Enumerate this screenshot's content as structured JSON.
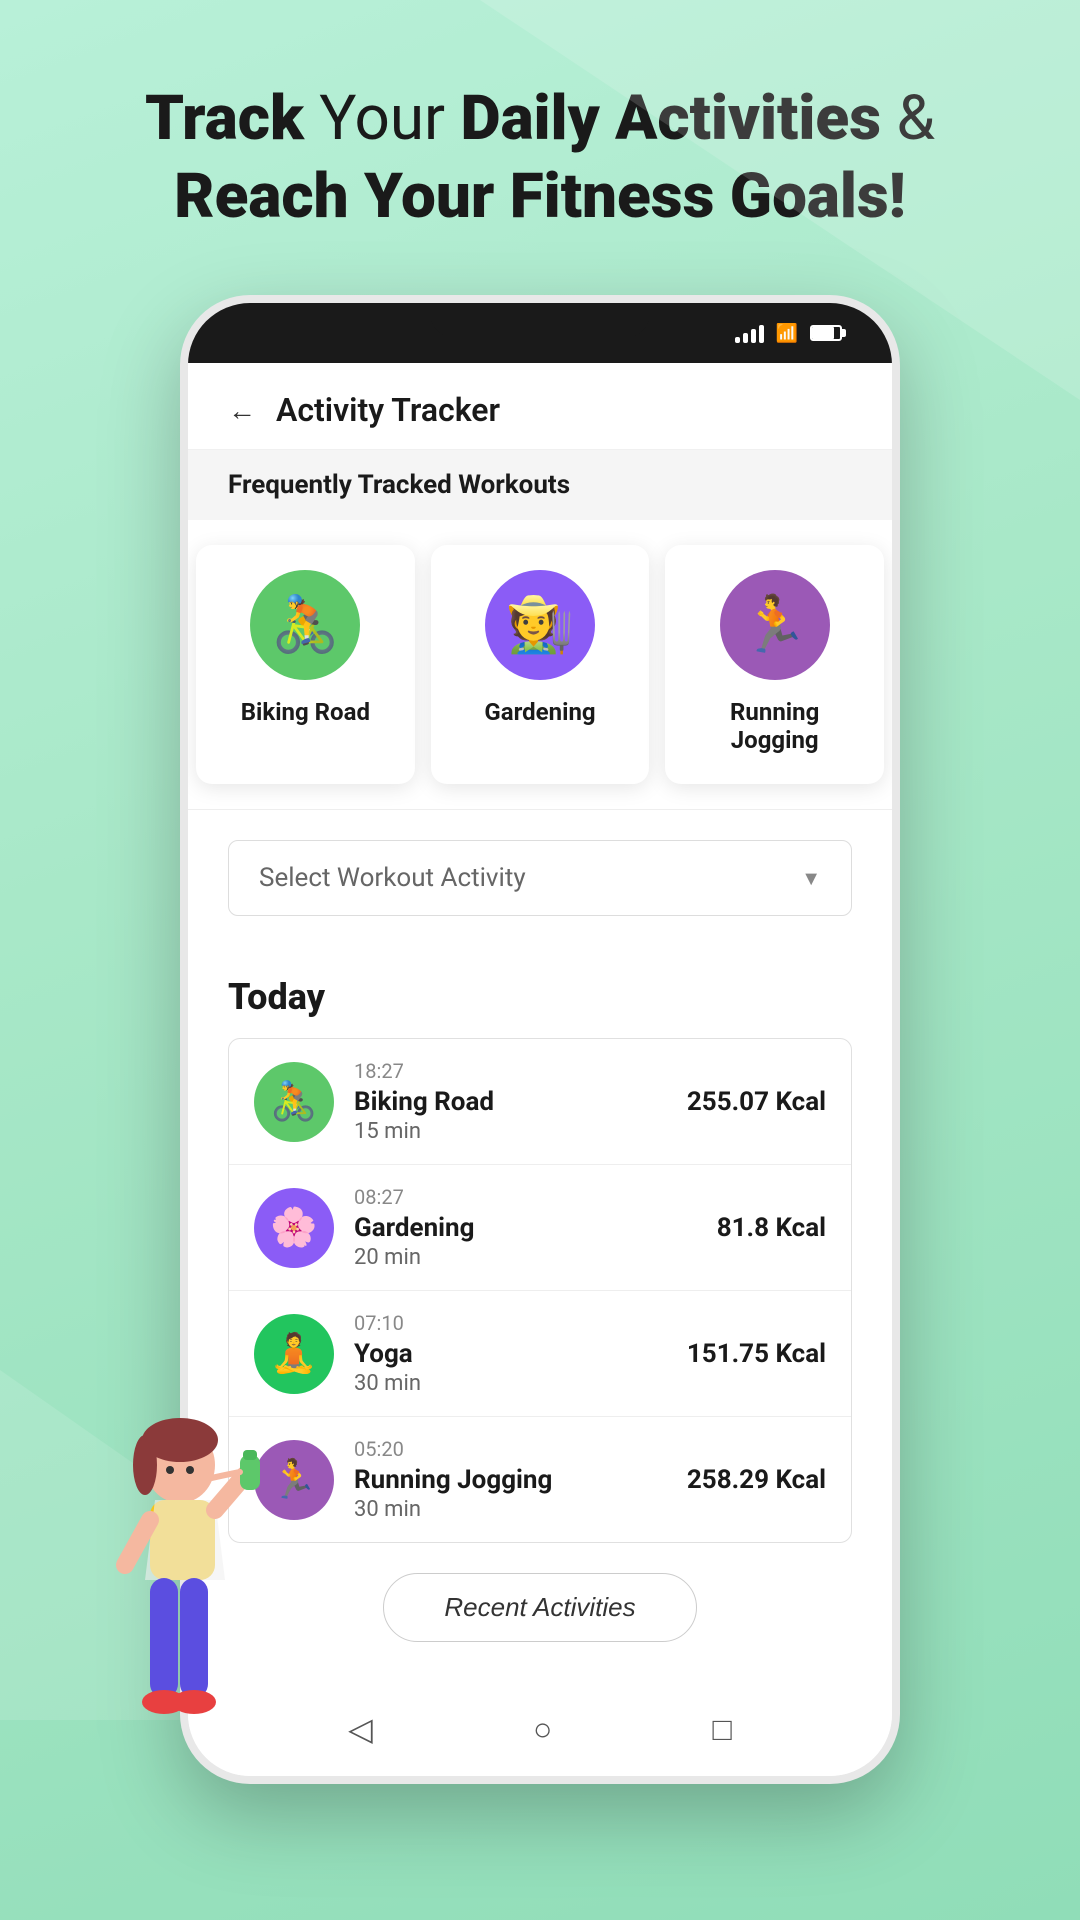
{
  "hero": {
    "line1_normal": "Track",
    "line1_bold1": " Your ",
    "line1_bold2": "Daily Activities",
    "line1_end": " &",
    "line2": "Reach Your Fitness Goals!"
  },
  "phone": {
    "app_title": "Activity Tracker",
    "back_label": "←",
    "section_label": "Frequently Tracked Workouts",
    "workouts": [
      {
        "name": "Biking Road",
        "emoji": "🚴",
        "bg": "#5DC86A",
        "id": "biking"
      },
      {
        "name": "Gardening",
        "emoji": "🧑‍🌾",
        "bg": "#8B5CF6",
        "id": "gardening"
      },
      {
        "name": "Running Jogging",
        "emoji": "🏃",
        "bg": "#9B59B6",
        "id": "running"
      }
    ],
    "dropdown": {
      "placeholder": "Select Workout Activity",
      "arrow": "▼"
    },
    "today_title": "Today",
    "activities": [
      {
        "time": "18:27",
        "name": "Biking Road",
        "duration": "15 min",
        "calories": "255.07 Kcal",
        "emoji": "🚴",
        "bg": "#5DC86A"
      },
      {
        "time": "08:27",
        "name": "Gardening",
        "duration": "20 min",
        "calories": "81.8 Kcal",
        "emoji": "🌸",
        "bg": "#8B5CF6"
      },
      {
        "time": "07:10",
        "name": "Yoga",
        "duration": "30 min",
        "calories": "151.75 Kcal",
        "emoji": "🧘",
        "bg": "#22C55E"
      },
      {
        "time": "05:20",
        "name": "Running Jogging",
        "duration": "30 min",
        "calories": "258.29 Kcal",
        "emoji": "🏃",
        "bg": "#9B59B6"
      }
    ],
    "recent_btn": "Recent Activities",
    "nav": {
      "back": "◁",
      "home": "○",
      "square": "□"
    }
  }
}
